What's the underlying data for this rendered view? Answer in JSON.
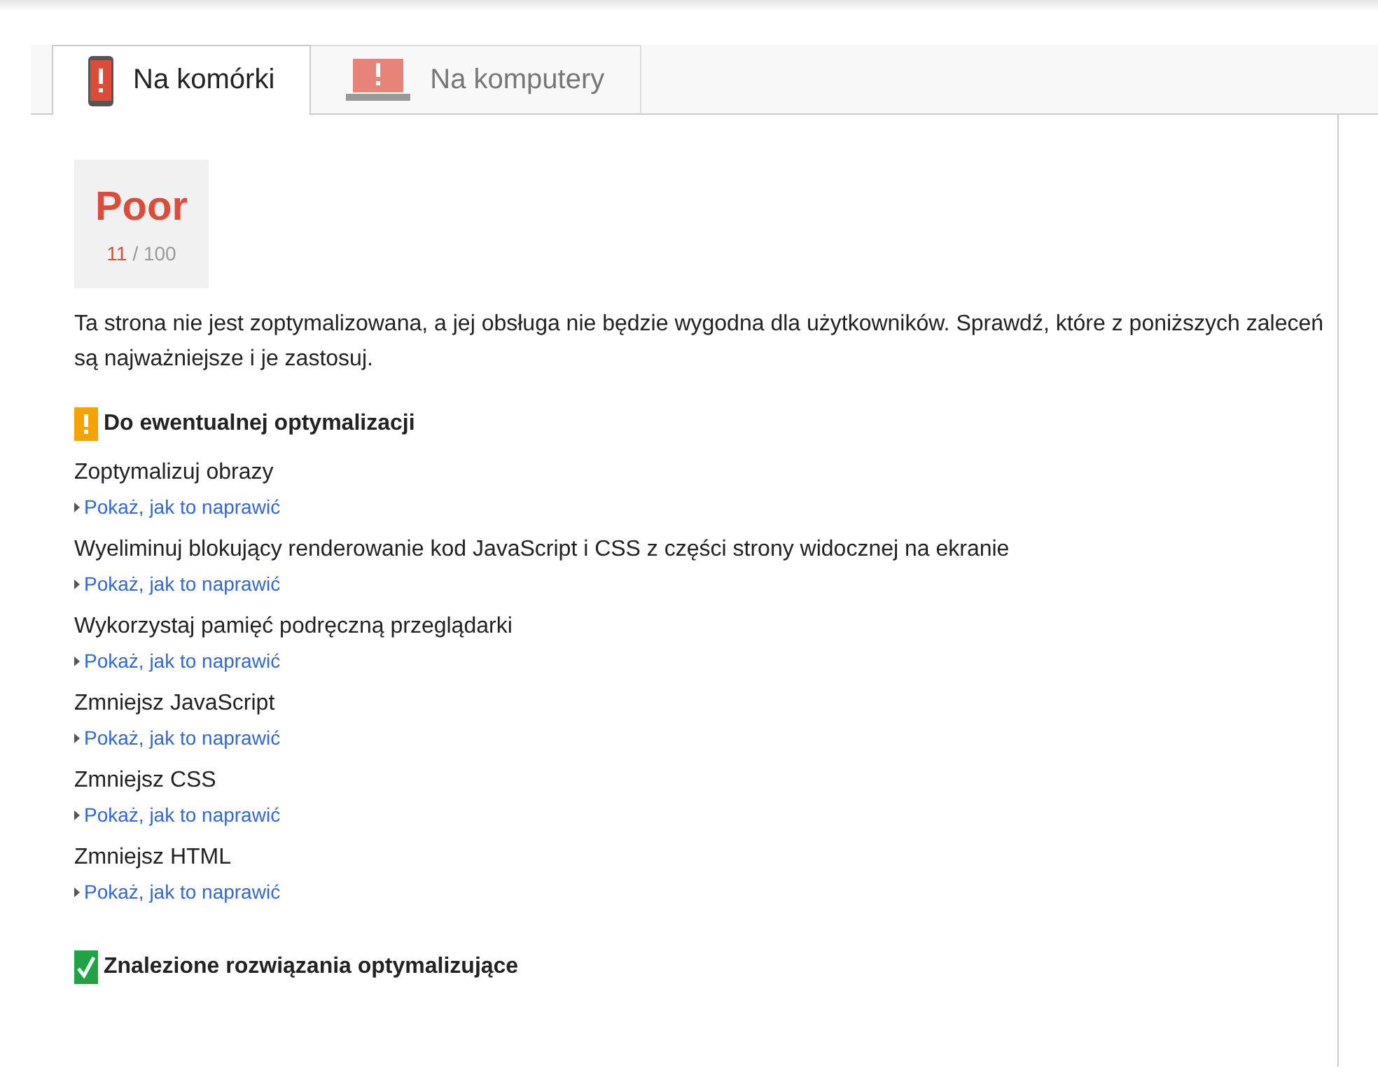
{
  "tabs": [
    {
      "kind": "mobile",
      "label": "Na komórki",
      "selected": true
    },
    {
      "kind": "desktop",
      "label": "Na komputery",
      "selected": false
    }
  ],
  "score": {
    "rating": "Poor",
    "value": "11",
    "max": "/ 100"
  },
  "summary": "Ta strona nie jest zoptymalizowana, a jej obsługa nie będzie wygodna dla użytkowników. Sprawdź, które z poniższych zaleceń są najważniejsze i je zastosuj.",
  "sections": [
    {
      "kind": "warning",
      "title": "Do ewentualnej optymalizacji",
      "items": [
        {
          "title": "Zoptymalizuj obrazy",
          "link": "Pokaż, jak to naprawić"
        },
        {
          "title": "Wyeliminuj blokujący renderowanie kod JavaScript i CSS z części strony widocznej na ekranie",
          "link": "Pokaż, jak to naprawić"
        },
        {
          "title": "Wykorzystaj pamięć podręczną przeglądarki",
          "link": "Pokaż, jak to naprawić"
        },
        {
          "title": "Zmniejsz JavaScript",
          "link": "Pokaż, jak to naprawić"
        },
        {
          "title": "Zmniejsz CSS",
          "link": "Pokaż, jak to naprawić"
        },
        {
          "title": "Zmniejsz HTML",
          "link": "Pokaż, jak to naprawić"
        }
      ]
    },
    {
      "kind": "ok",
      "title": "Znalezione rozwiązania optymalizujące"
    }
  ]
}
